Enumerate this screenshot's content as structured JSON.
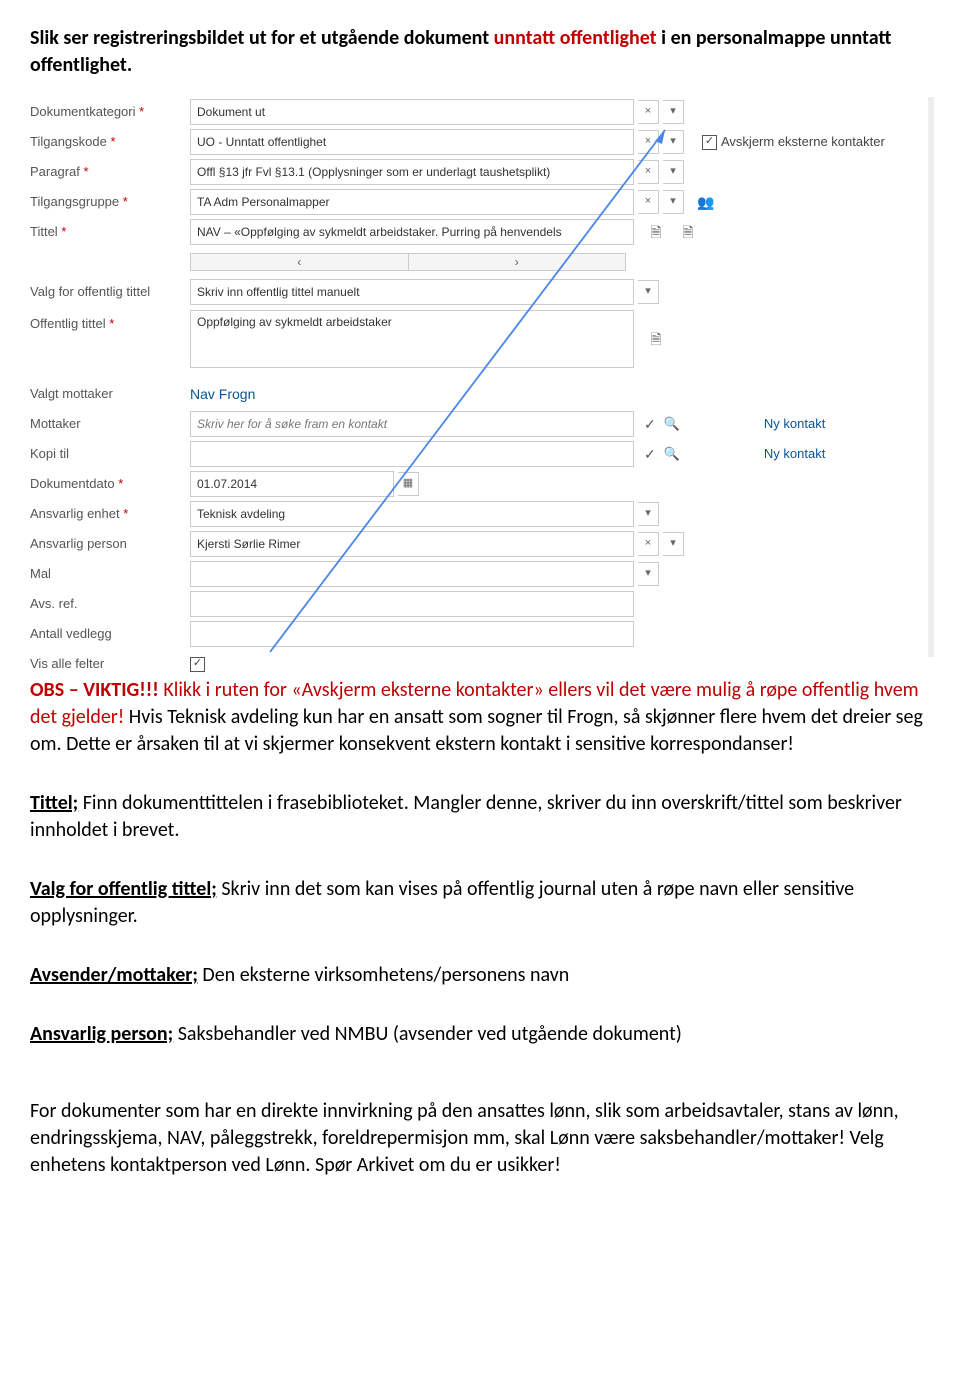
{
  "heading": {
    "p1a": "Slik ser registreringsbildet ut for et utgående dokument ",
    "p1b": "unntatt offentlighet",
    "p1c": " i en personalmappe unntatt offentlighet."
  },
  "form": {
    "labels": {
      "dokumentkategori": "Dokumentkategori",
      "tilgangskode": "Tilgangskode",
      "paragraf": "Paragraf",
      "tilgangsgruppe": "Tilgangsgruppe",
      "tittel": "Tittel",
      "valg_offentlig": "Valg for offentlig tittel",
      "offentlig_tittel": "Offentlig tittel",
      "valgt_mottaker": "Valgt mottaker",
      "mottaker": "Mottaker",
      "kopi_til": "Kopi til",
      "dokumentdato": "Dokumentdato",
      "ansvarlig_enhet": "Ansvarlig enhet",
      "ansvarlig_person": "Ansvarlig person",
      "mal": "Mal",
      "avs_ref": "Avs. ref.",
      "antall_vedlegg": "Antall vedlegg",
      "vis_alle_felter": "Vis alle felter"
    },
    "values": {
      "dokumentkategori": "Dokument ut",
      "tilgangskode": "UO - Unntatt offentlighet",
      "paragraf": "Offl §13 jfr Fvl §13.1 (Opplysninger som er underlagt taushetsplikt)",
      "tilgangsgruppe": "TA Adm Personalmapper",
      "tittel": "NAV – «Oppfølging av sykmeldt arbeidstaker. Purring på henvendels",
      "valg_offentlig": "Skriv inn offentlig tittel manuelt",
      "offentlig_tittel": "Oppfølging av sykmeldt arbeidstaker",
      "valgt_mottaker": "Nav Frogn",
      "mottaker_placeholder": "Skriv her for å søke fram en kontakt",
      "kopi_til": "",
      "dokumentdato": "01.07.2014",
      "ansvarlig_enhet": "Teknisk avdeling",
      "ansvarlig_person": "Kjersti Sørlie Rimer",
      "mal": "",
      "avs_ref": "",
      "antall_vedlegg": ""
    },
    "side": {
      "avskjerm": "Avskjerm eksterne kontakter",
      "ny_kontakt": "Ny kontakt"
    },
    "glyphs": {
      "x": "×",
      "down": "▾",
      "left": "‹",
      "right": "›",
      "check": "✓",
      "search": "🔍",
      "cal": "▦",
      "people": "👥",
      "doc": "🗎",
      "docplus": "🗎"
    }
  },
  "body": {
    "obs_label": "OBS – VIKTIG!!! ",
    "obs_text1": "Klikk i ruten for «Avskjerm eksterne kontakter» ellers vil det være mulig å røpe offentlig hvem det gjelder!",
    "obs_text2": " Hvis Teknisk avdeling kun har en ansatt som sogner til Frogn, så skjønner flere hvem det dreier seg om. Dette er årsaken til at vi skjermer konsekvent ekstern kontakt i sensitive korrespondanser!",
    "tittel_h": "Tittel;",
    "tittel_t": " Finn dokumenttittelen i frasebiblioteket. Mangler denne, skriver du inn overskrift/tittel som beskriver innholdet i brevet.",
    "valg_h": "Valg for offentlig tittel;",
    "valg_t": " Skriv inn det som kan vises på offentlig journal uten å røpe navn eller sensitive opplysninger.",
    "avs_h": "Avsender/mottaker;",
    "avs_t": " Den eksterne virksomhetens/personens navn",
    "ansv_h": "Ansvarlig person;",
    "ansv_t": " Saksbehandler ved NMBU (avsender ved utgående dokument)",
    "foot": "For dokumenter som har en direkte innvirkning på den ansattes lønn, slik som arbeidsavtaler, stans av lønn, endringsskjema, NAV, påleggstrekk, foreldrepermisjon mm, skal Lønn være saksbehandler/mottaker! Velg enhetens kontaktperson ved Lønn. Spør Arkivet om du er usikker!"
  }
}
